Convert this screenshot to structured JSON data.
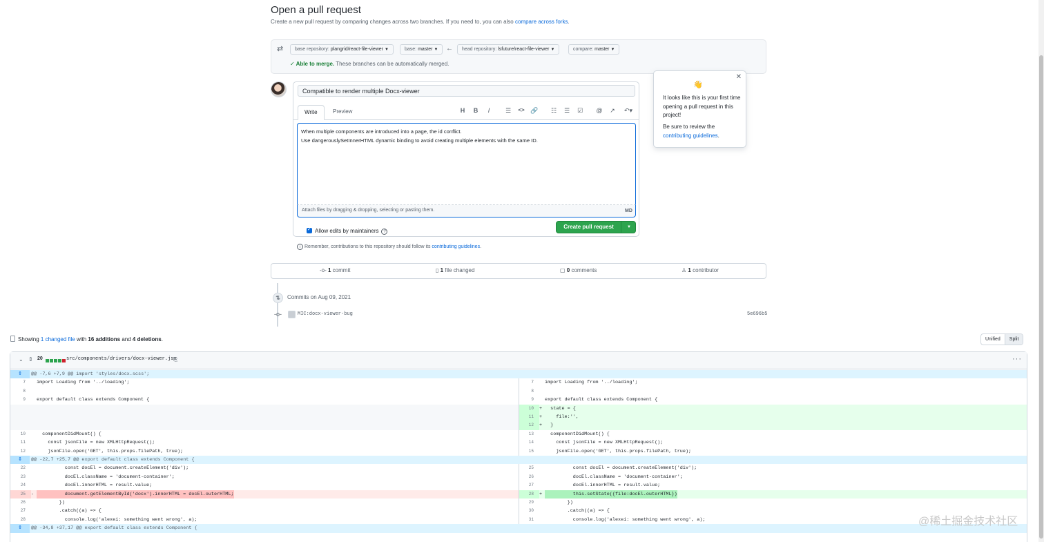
{
  "header": {
    "title": "Open a pull request",
    "subtitle": "Create a new pull request by comparing changes across two branches. If you need to, you can also ",
    "compare_link": "compare across forks",
    "subtitle_end": "."
  },
  "compare": {
    "base_repo_label": "base repository: ",
    "base_repo_value": "plangrid/react-file-viewer",
    "base_label": "base: ",
    "base_value": "master",
    "head_repo_label": "head repository: ",
    "head_repo_value": "lsfuture/react-file-viewer",
    "compare_label": "compare: ",
    "compare_value": "master",
    "merge_ok": "Able to merge.",
    "merge_text": " These branches can be automatically merged."
  },
  "form": {
    "title_value": "Compatible to render multiple Docx-viewer",
    "tab_write": "Write",
    "tab_preview": "Preview",
    "body_line1": "When multiple components are introduced into a page, the id conflict.",
    "body_line2": "Use dangerouslySetInnerHTML dynamic binding to avoid creating multiple elements with the same ID.",
    "attach_text": "Attach files by dragging & dropping, selecting or pasting them.",
    "markdown_badge": "MD",
    "allow_edits": "Allow edits by maintainers",
    "create_button": "Create pull request",
    "remember_text": "Remember, contributions to this repository should follow its ",
    "remember_link": "contributing guidelines",
    "remember_end": "."
  },
  "popover": {
    "text1": "It looks like this is your first time opening a pull request in this project!",
    "text2": "Be sure to review the ",
    "link": "contributing guidelines",
    "text2_end": "."
  },
  "stats": {
    "commits_num": "1",
    "commits_label": " commit",
    "files_num": "1",
    "files_label": " file changed",
    "comments_num": "0",
    "comments_label": " comments",
    "contrib_num": "1",
    "contrib_label": " contributor"
  },
  "commits": {
    "date_label": "Commits on Aug 09, 2021",
    "message": "MIC:docx-viewer-bug",
    "sha": "5e696b5"
  },
  "diff_summary": {
    "showing": "Showing ",
    "changed_link": "1 changed file",
    "with": " with ",
    "additions": "16 additions",
    "and": " and ",
    "deletions": "4 deletions",
    "end": ".",
    "unified": "Unified",
    "split": "Split"
  },
  "file": {
    "count": "20",
    "path": "src/components/drivers/docx-viewer.jsx"
  },
  "hunks": [
    "@@ -7,6 +7,9 @@ import 'styles/docx.scss';",
    "@@ -22,7 +25,7 @@ export default class extends Component {",
    "@@ -34,8 +37,17 @@ export default class extends Component {"
  ],
  "diff_lines": [
    {
      "ln": "7",
      "lc": "import Loading from '../loading';",
      "rn": "7",
      "rc": "import Loading from '../loading';"
    },
    {
      "ln": "8",
      "lc": "",
      "rn": "8",
      "rc": ""
    },
    {
      "ln": "9",
      "lc": "export default class extends Component {",
      "rn": "9",
      "rc": "export default class extends Component {"
    },
    {
      "ln": "",
      "lc": "",
      "rn": "10",
      "rc": "  state = {",
      "add": true
    },
    {
      "ln": "",
      "lc": "",
      "rn": "11",
      "rc": "    file:'',",
      "add": true
    },
    {
      "ln": "",
      "lc": "",
      "rn": "12",
      "rc": "  }",
      "add": true
    },
    {
      "ln": "10",
      "lc": "  componentDidMount() {",
      "rn": "13",
      "rc": "  componentDidMount() {"
    },
    {
      "ln": "11",
      "lc": "    const jsonFile = new XMLHttpRequest();",
      "rn": "14",
      "rc": "    const jsonFile = new XMLHttpRequest();"
    },
    {
      "ln": "12",
      "lc": "    jsonFile.open('GET', this.props.filePath, true);",
      "rn": "15",
      "rc": "    jsonFile.open('GET', this.props.filePath, true);"
    },
    {
      "ln": "22",
      "lc": "          const docEl = document.createElement('div');",
      "rn": "25",
      "rc": "          const docEl = document.createElement('div');"
    },
    {
      "ln": "23",
      "lc": "          docEl.className = 'document-container';",
      "rn": "26",
      "rc": "          docEl.className = 'document-container';"
    },
    {
      "ln": "24",
      "lc": "          docEl.innerHTML = result.value;",
      "rn": "27",
      "rc": "          docEl.innerHTML = result.value;"
    },
    {
      "ln": "25",
      "lc": "          document.getElementById('docx').innerHTML = docEl.outerHTML;",
      "rn": "28",
      "rc": "          this.setState({file:docEl.outerHTML})",
      "del": true,
      "add": true
    },
    {
      "ln": "26",
      "lc": "        })",
      "rn": "29",
      "rc": "        })"
    },
    {
      "ln": "27",
      "lc": "        .catch((a) => {",
      "rn": "30",
      "rc": "        .catch((a) => {"
    },
    {
      "ln": "28",
      "lc": "          console.log('alexei: something went wrong', a);",
      "rn": "31",
      "rc": "          console.log('alexei: something went wrong', a);"
    }
  ],
  "watermark": "@稀土掘金技术社区",
  "colors": {
    "primary_button": "#2da44e",
    "link": "#0969da",
    "addition": "#e6ffec",
    "deletion": "#ffebe9"
  }
}
